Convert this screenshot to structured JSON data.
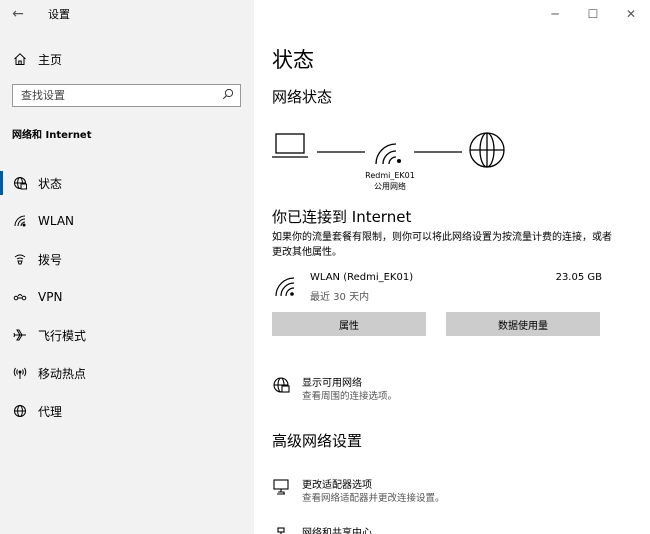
{
  "titlebar": {
    "app_title": "设置",
    "back_glyph": "←",
    "minimize_glyph": "─",
    "maximize_glyph": "☐",
    "close_glyph": "✕"
  },
  "sidebar": {
    "home_label": "主页",
    "search_placeholder": "查找设置",
    "section_title": "网络和 Internet",
    "items": [
      {
        "label": "状态",
        "icon": "globe-status-icon",
        "active": true
      },
      {
        "label": "WLAN",
        "icon": "wifi-icon",
        "active": false
      },
      {
        "label": "拨号",
        "icon": "dialup-icon",
        "active": false
      },
      {
        "label": "VPN",
        "icon": "vpn-icon",
        "active": false
      },
      {
        "label": "飞行模式",
        "icon": "airplane-icon",
        "active": false
      },
      {
        "label": "移动热点",
        "icon": "hotspot-icon",
        "active": false
      },
      {
        "label": "代理",
        "icon": "globe-icon",
        "active": false
      }
    ]
  },
  "main": {
    "page_title": "状态",
    "network_status_heading": "网络状态",
    "ssid": "Redmi_EK01",
    "network_type": "公用网络",
    "connected_heading": "你已连接到 Internet",
    "connected_desc": "如果你的流量套餐有限制，则你可以将此网络设置为按流量计费的连接，或者更改其他属性。",
    "connection": {
      "name": "WLAN (Redmi_EK01)",
      "period": "最近 30 天内",
      "usage": "23.05 GB"
    },
    "buttons": {
      "properties": "属性",
      "data_usage": "数据使用量"
    },
    "show_networks": {
      "title": "显示可用网络",
      "subtitle": "查看周围的连接选项。"
    },
    "advanced_heading": "高级网络设置",
    "adapter_options": {
      "title": "更改适配器选项",
      "subtitle": "查看网络适配器并更改连接设置。"
    },
    "sharing_center": {
      "title": "网络和共享中心"
    }
  },
  "colors": {
    "sidebar_bg": "#f2f2f2",
    "accent": "#005a9e",
    "button_bg": "#cccccc"
  }
}
